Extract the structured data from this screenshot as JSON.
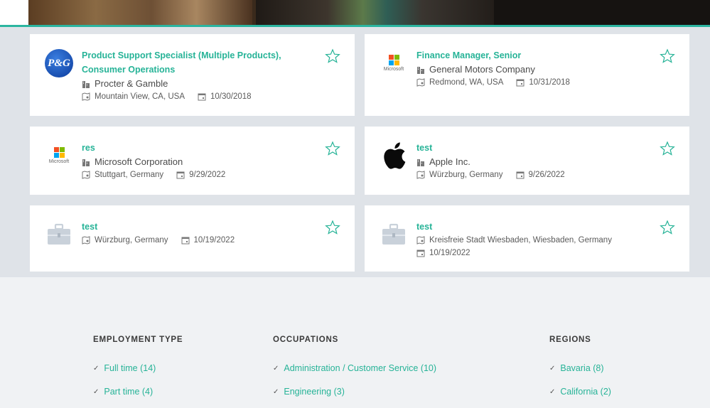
{
  "jobs": [
    {
      "title": "Product Support Specialist (Multiple Products), Consumer Operations",
      "company": "Procter & Gamble",
      "location": "Mountain View, CA, USA",
      "date": "10/30/2018",
      "logo": "pg"
    },
    {
      "title": "Finance Manager, Senior",
      "company": "General Motors Company",
      "location": "Redmond, WA, USA",
      "date": "10/31/2018",
      "logo": "microsoft"
    },
    {
      "title": "res",
      "company": "Microsoft Corporation",
      "location": "Stuttgart, Germany",
      "date": "9/29/2022",
      "logo": "microsoft"
    },
    {
      "title": "test",
      "company": "Apple Inc.",
      "location": "Würzburg, Germany",
      "date": "9/26/2022",
      "logo": "apple"
    },
    {
      "title": "test",
      "company": "",
      "location": "Würzburg, Germany",
      "date": "10/19/2022",
      "logo": "briefcase"
    },
    {
      "title": "test",
      "company": "",
      "location": "Kreisfreie Stadt Wiesbaden, Wiesbaden, Germany",
      "date": "10/19/2022",
      "logo": "briefcase"
    }
  ],
  "logos": {
    "pg_text": "P&G",
    "microsoft_text": "Microsoft"
  },
  "filters": {
    "employment_type": {
      "heading": "EMPLOYMENT TYPE",
      "items": [
        "Full time (14)",
        "Part time (4)"
      ]
    },
    "occupations": {
      "heading": "OCCUPATIONS",
      "items": [
        "Administration / Customer Service (10)",
        "Engineering (3)"
      ]
    },
    "regions": {
      "heading": "REGIONS",
      "items": [
        "Bavaria (8)",
        "California (2)"
      ]
    }
  },
  "colors": {
    "accent": "#26b397",
    "hero_rule": "#2bb5a0",
    "listing_bg": "#dfe3e8",
    "footer_bg": "#f0f2f4"
  }
}
